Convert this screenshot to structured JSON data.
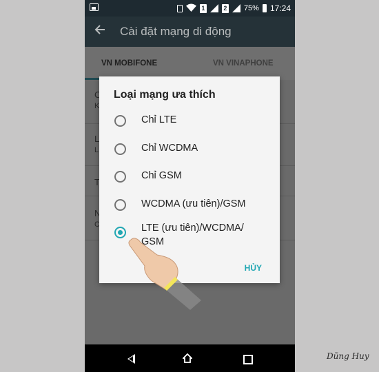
{
  "status_bar": {
    "sim1": "1",
    "sim2": "2",
    "battery": "75%",
    "time": "17:24"
  },
  "toolbar": {
    "title": "Cài đặt mạng di động"
  },
  "tabs": [
    {
      "label": "VN MOBIFONE"
    },
    {
      "label": "VN VINAPHONE"
    }
  ],
  "background_rows": [
    "C",
    "K",
    "L",
    "L",
    "T",
    "N",
    "C"
  ],
  "dialog": {
    "title": "Loại mạng ưa thích",
    "options": [
      {
        "label": "Chỉ LTE",
        "selected": false
      },
      {
        "label": "Chỉ WCDMA",
        "selected": false
      },
      {
        "label": "Chỉ GSM",
        "selected": false
      },
      {
        "label": "WCDMA (ưu tiên)/GSM",
        "selected": false
      },
      {
        "label": "LTE (ưu tiên)/WCDMA/ GSM",
        "selected": true
      }
    ],
    "cancel_label": "HỦY"
  },
  "colors": {
    "accent": "#21a7b3",
    "toolbar": "#253238",
    "status_bar": "#1e2a31"
  },
  "watermark": "Dũng Huy"
}
